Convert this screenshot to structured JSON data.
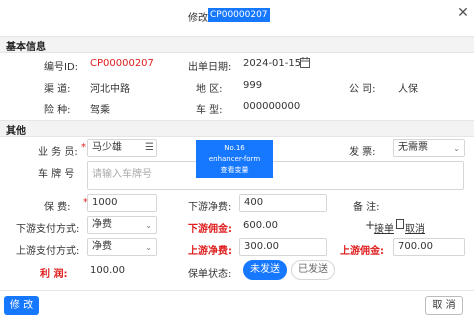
{
  "dialog": {
    "title_prefix": "修改",
    "title_code": "CP00000207",
    "close_icon": "close-icon"
  },
  "basic": {
    "section_title": "基本信息",
    "number_label": "编号ID:",
    "number_value": "CP00000207",
    "date_label": "出单日期:",
    "date_value": "2024-01-15",
    "channel_label": "渠    道:",
    "channel_value": "河北中路",
    "region_label": "地    区:",
    "region_value": "999",
    "company_label": "公    司:",
    "company_value": "人保",
    "insurance_label": "险    种:",
    "insurance_value": "驾乘",
    "vehicle_label": "车    型:",
    "vehicle_value": "000000000"
  },
  "other": {
    "section_title": "其他",
    "salesman_label": "业 务 员:",
    "salesman_value": "马少雄",
    "invoice_label": "发    票:",
    "invoice_value": "无需票",
    "plate_label": "车 牌 号",
    "plate_placeholder": "请输入车牌号",
    "premium_label": "保    费:",
    "premium_value": "1000",
    "downstream_net_label": "下游净费:",
    "downstream_net_value": "400",
    "remark_label": "备    注:",
    "down_pay_label": "下游支付方式:",
    "down_pay_value": "净费",
    "down_commission_label": "下游佣金:",
    "down_commission_value": "600.00",
    "add_order_label": "接单",
    "cancel_order_label": "取消",
    "up_pay_label": "上游支付方式:",
    "up_pay_value": "净费",
    "up_net_label": "上游净费:",
    "up_net_value": "300.00",
    "up_commission_label": "上游佣金:",
    "up_commission_value": "700.00",
    "profit_label": "利    润:",
    "profit_value": "100.00",
    "status_label": "保单状态:",
    "status_options": [
      "未发送",
      "已发送"
    ],
    "status_selected": "未发送"
  },
  "overlay": {
    "line1": "No.16",
    "line2": "enhancer-form",
    "line3": "查看变量"
  },
  "footer": {
    "submit_label": "修 改",
    "cancel_label": "取 消"
  },
  "colors": {
    "primary": "#1677ff",
    "required": "#e02020"
  }
}
